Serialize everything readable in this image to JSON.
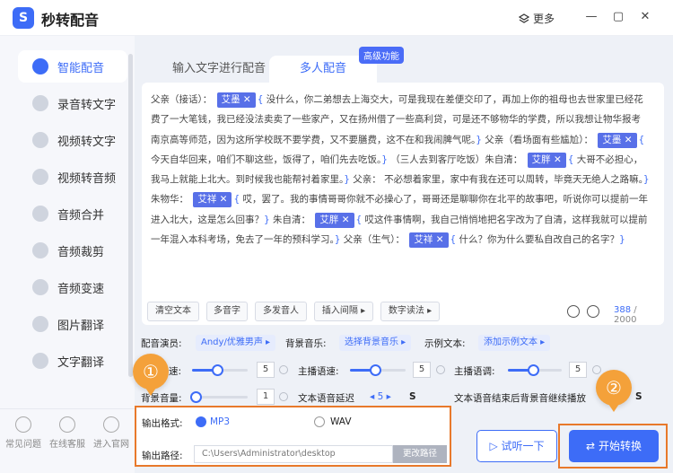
{
  "app": {
    "logo_glyph": "S",
    "title": "秒转配音",
    "more_label": "更多",
    "accent": "#3d6cf7",
    "highlight": "#e8792b"
  },
  "window": {
    "minimize": "—",
    "restore": "▢",
    "close": "✕"
  },
  "sidebar": {
    "items": [
      {
        "label": "智能配音",
        "active": true
      },
      {
        "label": "录音转文字"
      },
      {
        "label": "视频转文字"
      },
      {
        "label": "视频转音频"
      },
      {
        "label": "音频合并"
      },
      {
        "label": "音频裁剪"
      },
      {
        "label": "音频变速"
      },
      {
        "label": "图片翻译"
      },
      {
        "label": "文字翻译"
      }
    ],
    "bottom": [
      {
        "label": "常见问题"
      },
      {
        "label": "在线客服"
      },
      {
        "label": "进入官网"
      }
    ]
  },
  "tabs": {
    "input_text": "输入文字进行配音",
    "multi_voice": "多人配音",
    "badge": "高级功能"
  },
  "editor": {
    "lines": [
      "父亲（接话）：",
      "艾墨",
      "没什么，你二弟想去上海交大，可是我现在差便交印了，再加上你的祖母也去世家里已经花费了一大笔钱，我已经没法卖卖了一些家产，又在扬州借了一些高利贷，可是还不够物华的学费，所以我想让物华报考南京高等师范，因为这所学校既不要学费，又不要膳费，这不在和我闹脾气呢。",
      "父亲（看场面有些尴尬）：",
      "艾墨",
      "今天自华回来，咱们不聊这些，饭得了，咱们先去吃饭。",
      "（三人去到客厅吃饭）朱自清：",
      "艾胖",
      "大哥不必担心，我马上就能上北大。到时候我也能帮衬着家里。",
      "父亲：",
      "不必想着家里，家中有我在还可以周转，毕竟天无绝人之路嘛。",
      "朱物华：",
      "艾祥",
      "哎，罢了。我的事情哥哥你就不必操心了，哥哥还是聊聊你在北平的故事吧，听说你可以提前一年进入北大，这是怎么回事？",
      "朱自清：",
      "艾胖",
      "哎这件事情啊，我自己悄悄地把名字改为了自清，这样我就可以提前一年混入本科考场，免去了一年的预科学习。",
      "父亲（生气）：",
      "艾祥",
      "什么？你为什么要私自改自己的名字？"
    ]
  },
  "toolbar": {
    "clear": "清空文本",
    "polyphone": "多音字",
    "multi_speaker": "多发音人",
    "insert_pause": "插入间隔",
    "digit_read": "数字读法",
    "count": "388",
    "max": "/ 2000"
  },
  "settings": {
    "voice_label": "配音演员:",
    "voice_value": "Andy/优雅男声",
    "bgm_label": "背景音乐:",
    "bgm_value": "选择背景音乐",
    "sample_label": "示例文本:",
    "sample_value": "添加示例文本",
    "row2_label1": "速:",
    "row2_value1": "5",
    "row2_label2": "主播语速:",
    "row2_value2": "5",
    "row2_label3": "主播语调:",
    "row2_value3": "5",
    "bg_volume_label": "背景音量:",
    "bg_volume_value": "1",
    "delay_label": "文本语音延迟",
    "delay_value": "5",
    "delay_unit": "S",
    "tail_label": "文本语音结束后背景音继续播放",
    "tail_unit": "S"
  },
  "output": {
    "format_label": "输出格式:",
    "mp3": "MP3",
    "wav": "WAV",
    "path_label": "输出路径:",
    "path_value": "C:\\Users\\Administrator\\desktop",
    "change_path": "更改路径"
  },
  "actions": {
    "listen": "试听一下",
    "start": "开始转换"
  },
  "callouts": {
    "one": "①",
    "two": "②"
  }
}
